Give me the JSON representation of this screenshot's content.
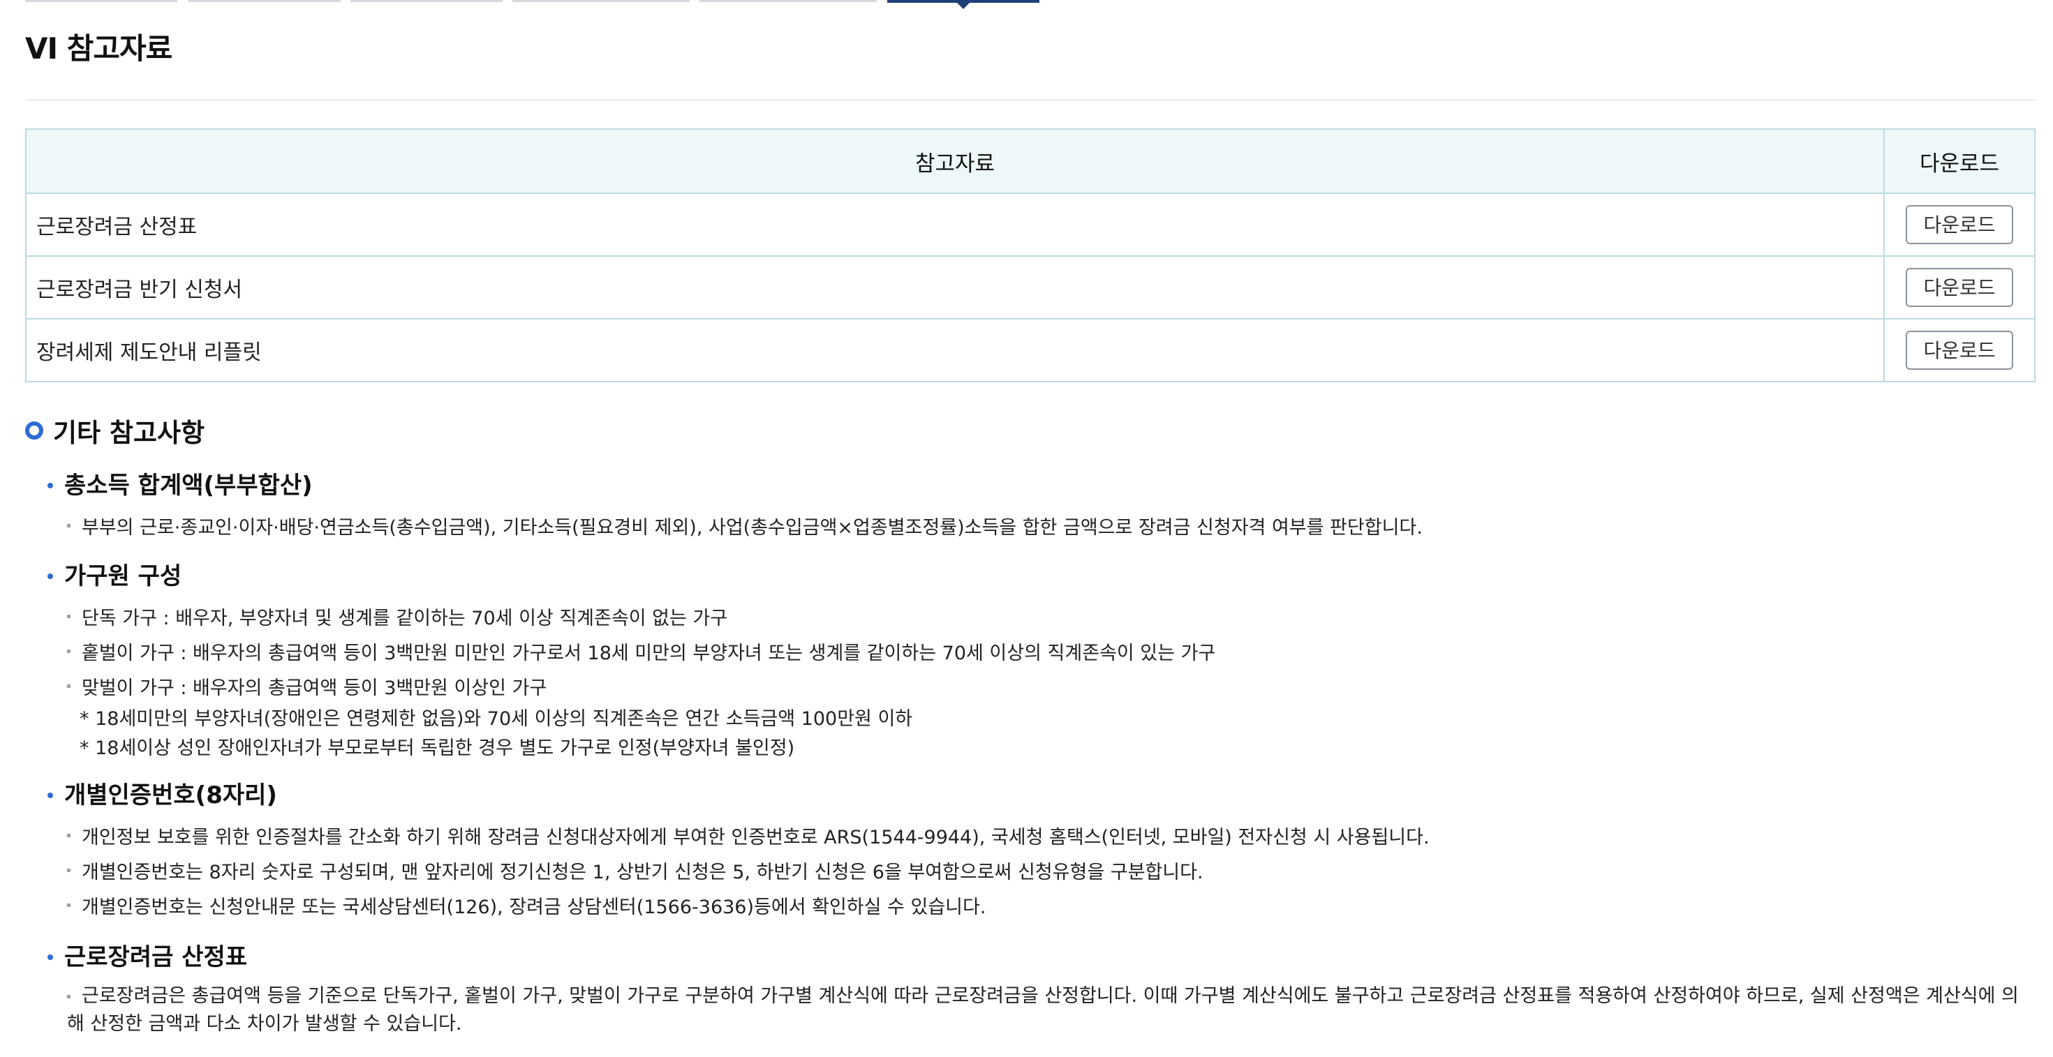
{
  "page": {
    "title": "VI 참고자료"
  },
  "table": {
    "headers": {
      "col1": "참고자료",
      "col2": "다운로드"
    },
    "rows": [
      {
        "name": "근로장려금 산정표",
        "button": "다운로드"
      },
      {
        "name": "근로장려금 반기 신청서",
        "button": "다운로드"
      },
      {
        "name": "장려세제 제도안내 리플릿",
        "button": "다운로드"
      }
    ]
  },
  "section": {
    "title": "기타 참고사항",
    "groups": [
      {
        "heading": "총소득 합계액(부부합산)",
        "items": [
          "부부의 근로·종교인·이자·배당·연금소득(총수입금액), 기타소득(필요경비 제외), 사업(총수입금액×업종별조정률)소득을 합한 금액으로 장려금 신청자격 여부를 판단합니다."
        ]
      },
      {
        "heading": "가구원 구성",
        "items": [
          "단독 가구 : 배우자, 부양자녀 및 생계를 같이하는 70세 이상 직계존속이 없는 가구",
          "홑벌이 가구 : 배우자의 총급여액 등이 3백만원 미만인 가구로서 18세 미만의 부양자녀 또는 생계를 같이하는 70세 이상의 직계존속이 있는 가구",
          "맞벌이 가구 : 배우자의 총급여액 등이 3백만원 이상인 가구"
        ],
        "notes": [
          "* 18세미만의 부양자녀(장애인은 연령제한 없음)와 70세 이상의 직계존속은 연간 소득금액 100만원 이하",
          "* 18세이상 성인 장애인자녀가 부모로부터 독립한 경우 별도 가구로 인정(부양자녀 불인정)"
        ]
      },
      {
        "heading": "개별인증번호(8자리)",
        "items": [
          "개인정보 보호를 위한 인증절차를 간소화 하기 위해 장려금 신청대상자에게 부여한 인증번호로 ARS(1544-9944), 국세청 홈택스(인터넷, 모바일) 전자신청 시 사용됩니다.",
          "개별인증번호는 8자리 숫자로 구성되며, 맨 앞자리에 정기신청은 1, 상반기 신청은 5, 하반기 신청은 6을 부여함으로써 신청유형을 구분합니다.",
          "개별인증번호는 신청안내문 또는 국세상담센터(126), 장려금 상담센터(1566-3636)등에서 확인하실 수 있습니다."
        ]
      },
      {
        "heading": "근로장려금 산정표",
        "items": [
          "근로장려금은 총급여액 등을 기준으로 단독가구, 홑벌이 가구, 맞벌이 가구로 구분하여 가구별 계산식에 따라 근로장려금을 산정합니다. 이때 가구별 계산식에도 불구하고 근로장려금 산정표를 적용하여 산정하여야 하므로, 실제 산정액은 계산식에 의해 산정한 금액과 다소 차이가 발생할 수 있습니다."
        ]
      }
    ]
  },
  "colors": {
    "accent": "#2d6dd2",
    "tab_active": "#1f3f7a",
    "table_border": "#bcdbe0",
    "table_header_bg": "#eef8f8"
  }
}
